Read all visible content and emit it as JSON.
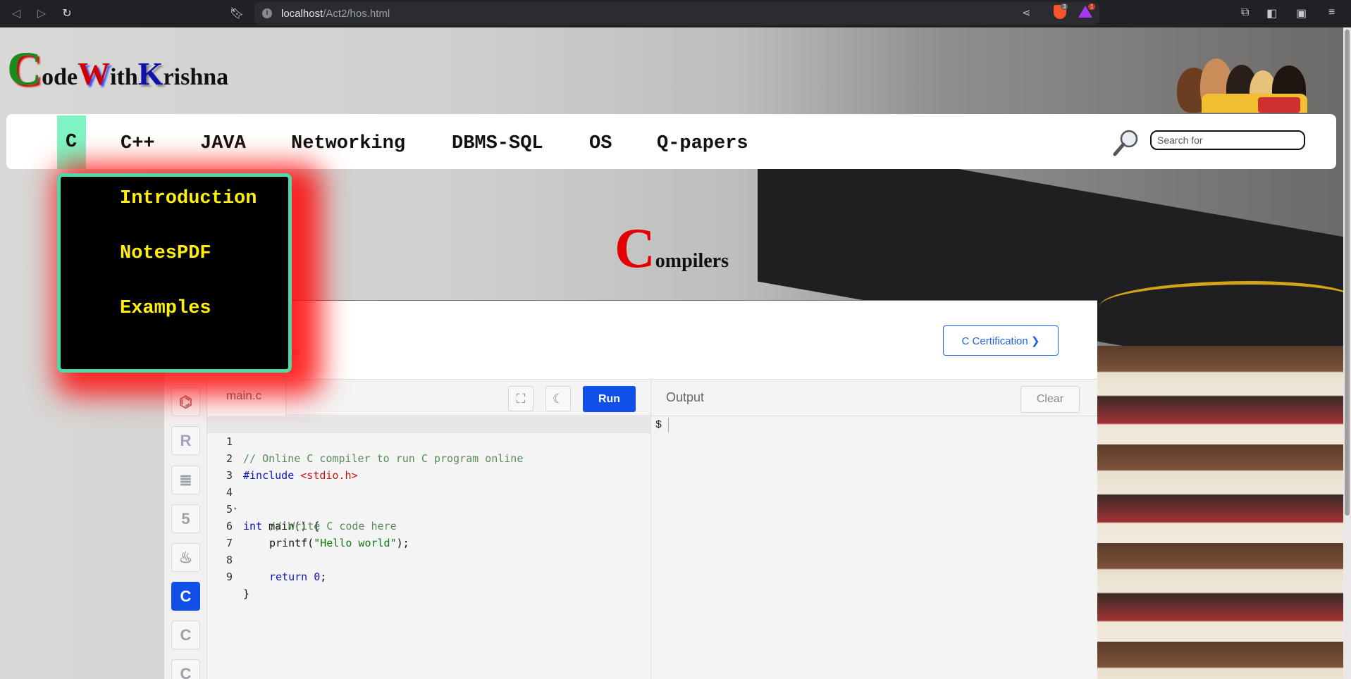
{
  "browser": {
    "url_host": "localhost",
    "url_path": "/Act2/hos.html",
    "brave_badge": "3",
    "rewards_badge": "1"
  },
  "logo": {
    "c": "C",
    "ode": "ode",
    "w": "W",
    "ith": "ith",
    "k": "K",
    "rishna": "rishna"
  },
  "nav": {
    "items": [
      "C",
      "C++",
      "JAVA",
      "Networking",
      "DBMS-SQL",
      "OS",
      "Q-papers"
    ],
    "search_placeholder": "Search for"
  },
  "dropdown": {
    "items": [
      "Introduction",
      "NotesPDF",
      "Examples"
    ]
  },
  "heading": {
    "big": "C",
    "rest": "ompilers"
  },
  "compiler": {
    "cert_button": "C Certification ❯",
    "faint_text": "er",
    "file_tab": "main.c",
    "run_label": "Run",
    "output_label": "Output",
    "clear_label": "Clear",
    "prompt": "$",
    "line_numbers": [
      "1",
      "2",
      "3",
      "4",
      "5",
      "6",
      "7",
      "8",
      "9"
    ],
    "code": {
      "l1_comment": "// Online C compiler to run C program online",
      "l2_include": "#include",
      "l2_header": "<stdio.h>",
      "l4_kw": "int",
      "l4_rest": " main() {",
      "l5_comment": "// Write C code here",
      "l6_fn": "printf(",
      "l6_str": "\"Hello world\"",
      "l6_end": ");",
      "l8_kw": "return",
      "l8_num": "0",
      "l8_end": ";",
      "l9": "}"
    },
    "lang_icons": [
      "python-icon",
      "r-icon",
      "sql-icon",
      "html5-icon",
      "java-icon",
      "c-icon",
      "cpp-icon",
      "csharp-icon"
    ]
  },
  "colors": {
    "nav_active": "#7ff4c3",
    "dropdown_text": "#ffee10",
    "run_button": "#1150e8",
    "heading_c": "#e40000"
  }
}
